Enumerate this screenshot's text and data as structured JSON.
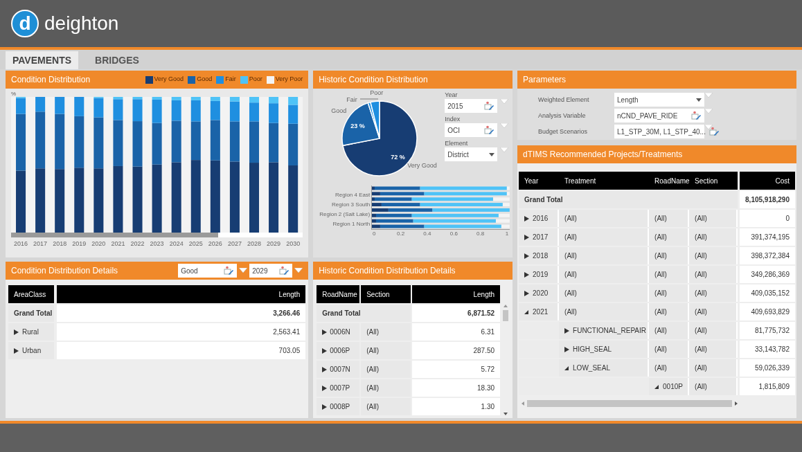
{
  "app": {
    "logo_letter": "d",
    "name": "deighton"
  },
  "tabs": [
    {
      "label": "PAVEMENTS",
      "selected": true
    },
    {
      "label": "BRIDGES",
      "selected": false
    }
  ],
  "condition_distribution": {
    "title": "Condition Distribution",
    "y_unit": "%",
    "legend": [
      {
        "label": "Very Good",
        "color": "#173d73"
      },
      {
        "label": "Good",
        "color": "#1a63a8"
      },
      {
        "label": "Fair",
        "color": "#1f8fe0"
      },
      {
        "label": "Poor",
        "color": "#4fc3f7"
      },
      {
        "label": "Very Poor",
        "color": "#f4f4f4"
      }
    ],
    "years": [
      "2016",
      "2017",
      "2018",
      "2019",
      "2020",
      "2021",
      "2022",
      "2023",
      "2024",
      "2025",
      "2026",
      "2027",
      "2028",
      "2029",
      "2030"
    ]
  },
  "condition_details": {
    "title": "Condition Distribution Details",
    "filters": [
      "Good",
      "2029"
    ],
    "columns": [
      "AreaClass",
      "Length"
    ],
    "total": {
      "label": "Grand Total",
      "value": "3,266.46"
    },
    "rows": [
      {
        "label": "Rural",
        "value": "2,563.41",
        "expanded": false
      },
      {
        "label": "Urban",
        "value": "703.05",
        "expanded": false
      }
    ]
  },
  "historic": {
    "title": "Historic Condition Distribution",
    "pie_labels": [
      "Poor",
      "Fair",
      "Good",
      "23 %",
      "72 %",
      "Very Good"
    ],
    "filters": [
      {
        "label": "Year",
        "value": "2015",
        "kind": "filter"
      },
      {
        "label": "Index",
        "value": "OCI",
        "kind": "filter"
      },
      {
        "label": "Element",
        "value": "District",
        "kind": "dropdown"
      }
    ],
    "regions": [
      "Region 4 East",
      "Region 3 South",
      "Region 2 (Salt Lake)",
      "Region 1 North"
    ],
    "ticks": [
      "0",
      "0.2",
      "0.4",
      "0.6",
      "0.8",
      "1"
    ]
  },
  "historic_details": {
    "title": "Historic Condition Distribution Details",
    "columns": [
      "RoadName",
      "Section",
      "Length"
    ],
    "total": {
      "label": "Grand Total",
      "value": "6,871.52"
    },
    "rows": [
      {
        "road": "0006N",
        "section": "(All)",
        "value": "6.31",
        "expanded": false
      },
      {
        "road": "0006P",
        "section": "(All)",
        "value": "287.50",
        "expanded": false
      },
      {
        "road": "0007N",
        "section": "(All)",
        "value": "5.72",
        "expanded": false
      },
      {
        "road": "0007P",
        "section": "(All)",
        "value": "18.30",
        "expanded": false
      },
      {
        "road": "0008P",
        "section": "(All)",
        "value": "1.30",
        "expanded": false
      }
    ]
  },
  "parameters": {
    "title": "Parameters",
    "items": [
      {
        "label": "Weighted Element",
        "value": "Length",
        "kind": "dropdown"
      },
      {
        "label": "Analysis Variable",
        "value": "nCND_PAVE_RIDE",
        "kind": "filter"
      },
      {
        "label": "Budget Scenarios",
        "value": "L1_STP_30M, L1_STP_40...",
        "kind": "filter"
      }
    ]
  },
  "treatments": {
    "title": "dTIMS Recommended Projects/Treatments",
    "columns": [
      "Year",
      "Treatment",
      "RoadName",
      "Section",
      "Cost"
    ],
    "total": {
      "label": "Grand Total",
      "cost": "8,105,918,290"
    },
    "rows": [
      {
        "cells": [
          "2016",
          "(All)",
          "(All)",
          "(All)"
        ],
        "cost": "0",
        "expanded": false
      },
      {
        "cells": [
          "2017",
          "(All)",
          "(All)",
          "(All)"
        ],
        "cost": "391,374,195",
        "expanded": false
      },
      {
        "cells": [
          "2018",
          "(All)",
          "(All)",
          "(All)"
        ],
        "cost": "398,372,384",
        "expanded": false
      },
      {
        "cells": [
          "2019",
          "(All)",
          "(All)",
          "(All)"
        ],
        "cost": "349,286,369",
        "expanded": false
      },
      {
        "cells": [
          "2020",
          "(All)",
          "(All)",
          "(All)"
        ],
        "cost": "409,035,152",
        "expanded": false
      },
      {
        "cells": [
          "2021",
          "(All)",
          "(All)",
          "(All)"
        ],
        "cost": "409,693,829",
        "expanded": true,
        "children": [
          {
            "cells": [
              "",
              "FUNCTIONAL_REPAIR",
              "(All)",
              "(All)"
            ],
            "cost": "81,775,732",
            "expanded": false
          },
          {
            "cells": [
              "",
              "HIGH_SEAL",
              "(All)",
              "(All)"
            ],
            "cost": "33,143,782",
            "expanded": false
          },
          {
            "cells": [
              "",
              "LOW_SEAL",
              "(All)",
              "(All)"
            ],
            "cost": "59,026,339",
            "expanded": true,
            "children": [
              {
                "cells": [
                  "",
                  "",
                  "0010P",
                  "(All)"
                ],
                "cost": "1,815,809",
                "expanded": true
              }
            ]
          }
        ]
      }
    ]
  }
}
